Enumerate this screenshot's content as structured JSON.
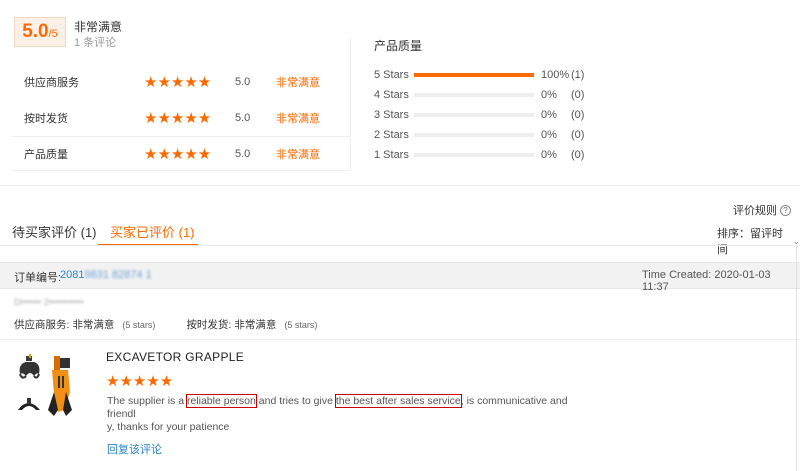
{
  "summary": {
    "score_main": "5.0",
    "score_suffix": "/5",
    "title": "非常满意",
    "review_count": "1 条评论"
  },
  "dimensions": [
    {
      "label": "供应商服务",
      "rating": "5.0",
      "text": "非常满意"
    },
    {
      "label": "按时发货",
      "rating": "5.0",
      "text": "非常满意"
    },
    {
      "label": "产品质量",
      "rating": "5.0",
      "text": "非常满意"
    }
  ],
  "quality": {
    "title": "产品质量",
    "rows": [
      {
        "label": "5 Stars",
        "fraction": 1.0,
        "percent": "100%",
        "count": "(1)"
      },
      {
        "label": "4 Stars",
        "fraction": 0.0,
        "percent": "0%",
        "count": "(0)"
      },
      {
        "label": "3 Stars",
        "fraction": 0.0,
        "percent": "0%",
        "count": "(0)"
      },
      {
        "label": "2 Stars",
        "fraction": 0.0,
        "percent": "0%",
        "count": "(0)"
      },
      {
        "label": "1 Stars",
        "fraction": 0.0,
        "percent": "0%",
        "count": "(0)"
      }
    ]
  },
  "rules_link": "评价规则",
  "sort": {
    "label": "排序：留评时间"
  },
  "tabs": [
    {
      "label": "待买家评价 (1)"
    },
    {
      "label": "买家已评价 (1)"
    }
  ],
  "order": {
    "label": "订单编号:",
    "number": "2081",
    "time_created": "Time Created: 2020-01-03 11:37",
    "buyer_masked": "Di•••••• 2•••••••••••"
  },
  "review": {
    "supplier_service_label": "供应商服务:",
    "supplier_service_value": "非常满意",
    "supplier_service_stars": "(5 stars)",
    "on_time_label": "按时发货:",
    "on_time_value": "非常满意",
    "on_time_stars": "(5 stars)",
    "product_title": "EXCAVETOR GRAPPLE",
    "text_1": "The supplier is a ",
    "text_hl1": "reliable person",
    "text_2": " and tries to give ",
    "text_hl2": "the best after sales service",
    "text_3": ", is communicative and friendl",
    "text_4": "y, thanks for your patience",
    "reply_link": "回复该评论"
  },
  "colors": {
    "accent": "#ff6a00",
    "link": "#2a84cc",
    "highlight": "#cc0000"
  }
}
